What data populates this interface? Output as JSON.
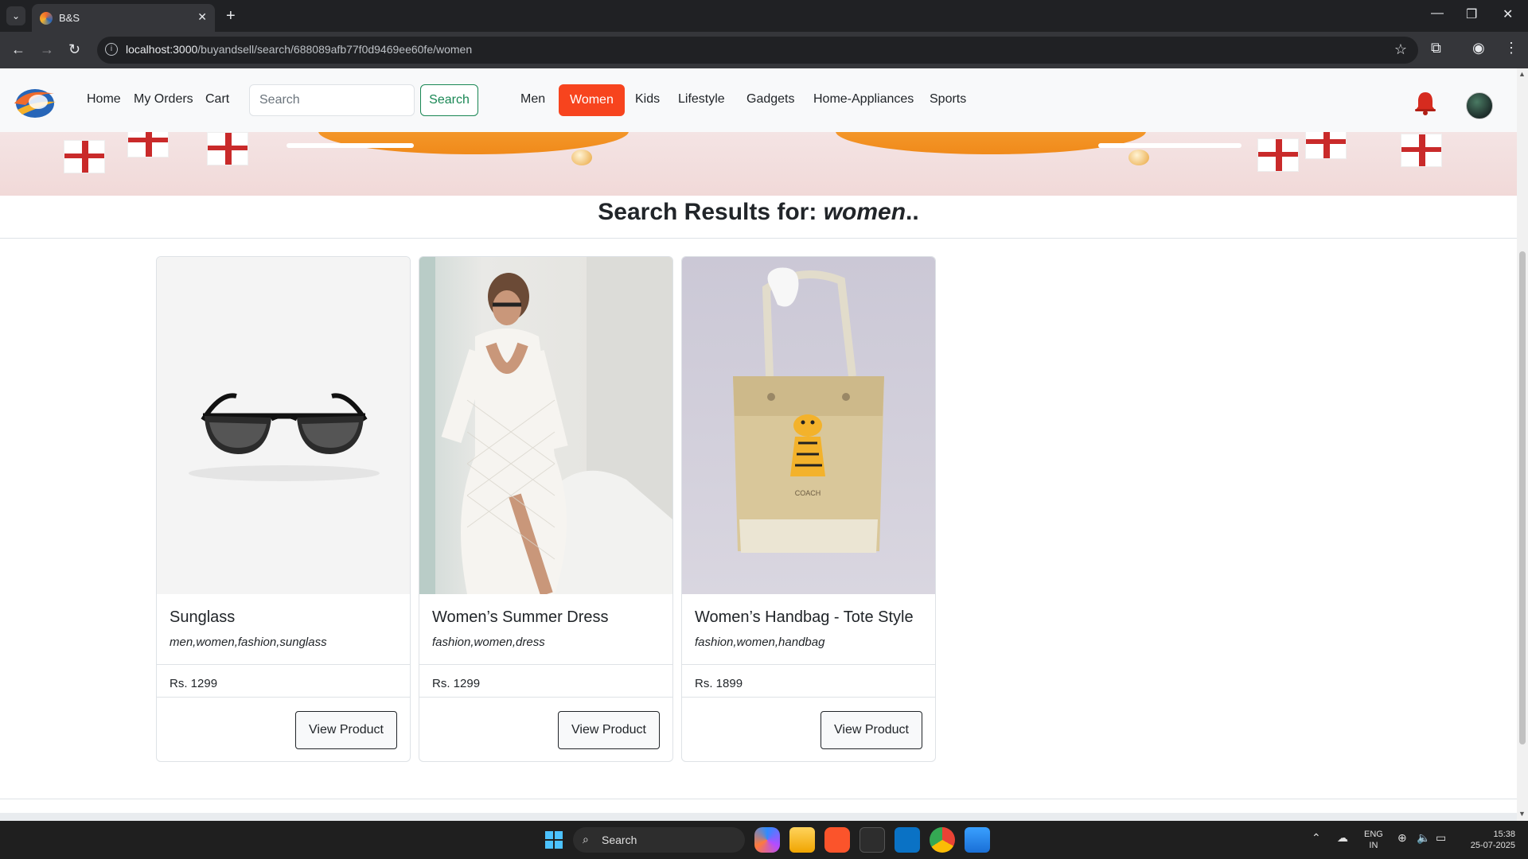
{
  "browser": {
    "tab_title": "B&S",
    "tab_close": "✕",
    "new_tab": "+",
    "url_host": "localhost:3000",
    "url_path": "/buyandsell/search/688089afb77f0d9469ee60fe/women"
  },
  "navbar": {
    "links": [
      "Home",
      "My Orders",
      "Cart"
    ],
    "search_placeholder": "Search",
    "search_button": "Search",
    "categories": [
      "Men",
      "Women",
      "Kids",
      "Lifestyle",
      "Gadgets",
      "Home-Appliances",
      "Sports"
    ],
    "active_category": "Women",
    "accent_color": "#f7441e"
  },
  "results": {
    "prefix": "Search Results for: ",
    "query": "women",
    "suffix": ".."
  },
  "products": [
    {
      "name": "Sunglass",
      "tags": "men,women,fashion,sunglass",
      "price": "Rs. 1299",
      "button": "View Product",
      "image": "sunglasses"
    },
    {
      "name": "Women’s Summer Dress",
      "tags": "fashion,women,dress",
      "price": "Rs. 1299",
      "button": "View Product",
      "image": "woman-in-white-lace-dress"
    },
    {
      "name": "Women’s Handbag - Tote Style",
      "tags": "fashion,women,handbag",
      "price": "Rs. 1899",
      "button": "View Product",
      "image": "tote-handbag"
    }
  ],
  "taskbar": {
    "search_label": "Search",
    "lang_top": "ENG",
    "lang_bottom": "IN",
    "time": "15:38",
    "date": "25-07-2025"
  }
}
